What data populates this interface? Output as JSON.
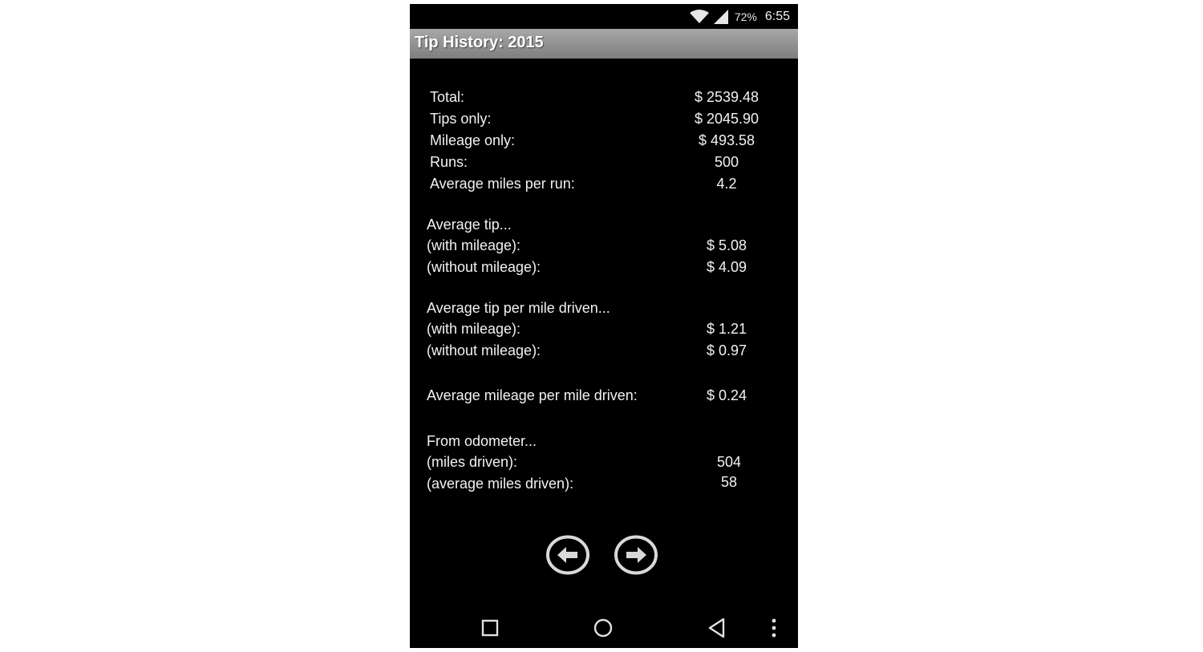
{
  "status_bar": {
    "battery": "72%",
    "time": "6:55",
    "icons": [
      "wifi-icon",
      "signal-icon"
    ]
  },
  "title": "Tip History: 2015",
  "summary": [
    {
      "label": "Total:",
      "value": "$ 2539.48"
    },
    {
      "label": "Tips only:",
      "value": "$ 2045.90"
    },
    {
      "label": "Mileage only:",
      "value": "$ 493.58"
    },
    {
      "label": "Runs:",
      "value": "500"
    },
    {
      "label": "Average miles per run:",
      "value": "4.2"
    }
  ],
  "average_tip": {
    "heading": "Average tip...",
    "rows": [
      {
        "label": "(with mileage):",
        "value": "$ 5.08"
      },
      {
        "label": "(without mileage):",
        "value": "$ 4.09"
      }
    ]
  },
  "average_tip_per_mile": {
    "heading": "Average tip per mile driven...",
    "rows": [
      {
        "label": "(with mileage):",
        "value": "$ 1.21"
      },
      {
        "label": "(without mileage):",
        "value": "$ 0.97"
      }
    ]
  },
  "average_mileage": {
    "label": "Average mileage per mile driven:",
    "value": "$ 0.24"
  },
  "odometer": {
    "heading": "From odometer...",
    "rows": [
      {
        "label": "(miles driven):",
        "value": "504"
      },
      {
        "label": "(average miles driven):",
        "value": "58"
      }
    ]
  },
  "navigation": {
    "prev_icon": "arrow-left-circle-icon",
    "next_icon": "arrow-right-circle-icon"
  },
  "system_nav": [
    "recents-square-icon",
    "home-circle-icon",
    "back-triangle-icon",
    "overflow-menu-icon"
  ],
  "colors": {
    "background": "#000000",
    "title_bar": "#8e8e8e",
    "text": "#f2f2f2"
  }
}
